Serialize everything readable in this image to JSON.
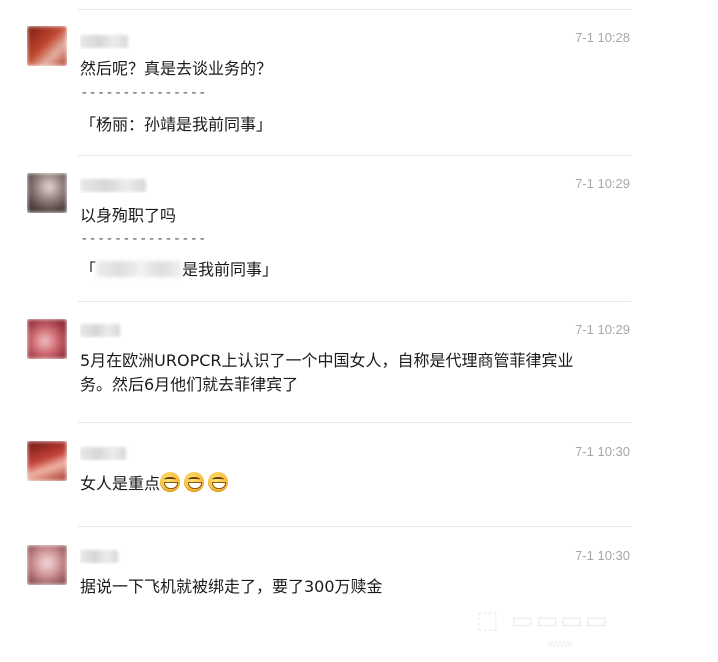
{
  "comments": [
    {
      "time": "7-1 10:28",
      "text": "然后呢？真是去谈业务的？",
      "dashes": "---------------",
      "quote": "「杨丽：孙靖是我前同事」",
      "avatar_color": "#b5402a"
    },
    {
      "time": "7-1 10:29",
      "text": "以身殉职了吗",
      "dashes": "---------------",
      "quote_start": "「",
      "quote_end": "是我前同事」",
      "avatar_color": "#6f6462"
    },
    {
      "time": "7-1 10:29",
      "text": "5月在欧洲UROPCR上认识了一个中国女人，自称是代理商管菲律宾业务。然后6月他们就去菲律宾了",
      "avatar_color": "#c34a55"
    },
    {
      "time": "7-1 10:30",
      "text": "女人是重点",
      "emoji_icons": [
        "grin-squint-icon",
        "grin-squint-icon",
        "grin-squint-icon"
      ],
      "avatar_color": "#b5352b"
    },
    {
      "time": "7-1 10:30",
      "text": "据说一下飞机就被绑走了，要了300万赎金",
      "avatar_color": "#b8787a"
    }
  ]
}
